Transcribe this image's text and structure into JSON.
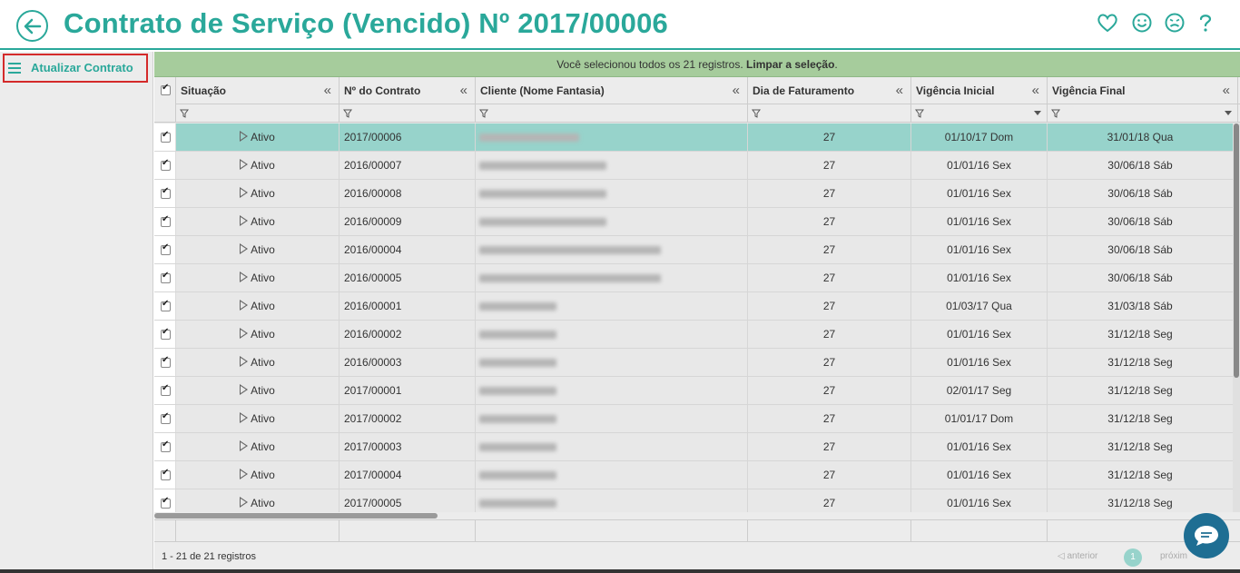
{
  "header": {
    "title": "Contrato de Serviço (Vencido) Nº 2017/00006",
    "icons": [
      "back-arrow-icon",
      "heart-icon",
      "smile-icon",
      "frown-icon",
      "question-icon"
    ]
  },
  "sidebar": {
    "items": [
      {
        "label": "Atualizar Contrato",
        "icon": "hamburger-icon"
      }
    ]
  },
  "banner": {
    "text": "Você selecionou todos os 21 registros.",
    "link": "Limpar a seleção",
    "suffix": "."
  },
  "grid": {
    "columns": [
      {
        "label": "Situação"
      },
      {
        "label": "Nº do Contrato"
      },
      {
        "label": "Cliente (Nome Fantasia)"
      },
      {
        "label": "Dia de Faturamento"
      },
      {
        "label": "Vigência Inicial"
      },
      {
        "label": "Vigência Final"
      }
    ],
    "collapse_glyph": "«",
    "rows": [
      {
        "status": "Ativo",
        "contract": "2017/00006",
        "day": "27",
        "start": "01/10/17 Dom",
        "end": "31/01/18 Qua",
        "selected": true
      },
      {
        "status": "Ativo",
        "contract": "2016/00007",
        "day": "27",
        "start": "01/01/16 Sex",
        "end": "30/06/18 Sáb"
      },
      {
        "status": "Ativo",
        "contract": "2016/00008",
        "day": "27",
        "start": "01/01/16 Sex",
        "end": "30/06/18 Sáb"
      },
      {
        "status": "Ativo",
        "contract": "2016/00009",
        "day": "27",
        "start": "01/01/16 Sex",
        "end": "30/06/18 Sáb"
      },
      {
        "status": "Ativo",
        "contract": "2016/00004",
        "day": "27",
        "start": "01/01/16 Sex",
        "end": "30/06/18 Sáb"
      },
      {
        "status": "Ativo",
        "contract": "2016/00005",
        "day": "27",
        "start": "01/01/16 Sex",
        "end": "30/06/18 Sáb"
      },
      {
        "status": "Ativo",
        "contract": "2016/00001",
        "day": "27",
        "start": "01/03/17 Qua",
        "end": "31/03/18 Sáb"
      },
      {
        "status": "Ativo",
        "contract": "2016/00002",
        "day": "27",
        "start": "01/01/16 Sex",
        "end": "31/12/18 Seg"
      },
      {
        "status": "Ativo",
        "contract": "2016/00003",
        "day": "27",
        "start": "01/01/16 Sex",
        "end": "31/12/18 Seg"
      },
      {
        "status": "Ativo",
        "contract": "2017/00001",
        "day": "27",
        "start": "02/01/17 Seg",
        "end": "31/12/18 Seg"
      },
      {
        "status": "Ativo",
        "contract": "2017/00002",
        "day": "27",
        "start": "01/01/17 Dom",
        "end": "31/12/18 Seg"
      },
      {
        "status": "Ativo",
        "contract": "2017/00003",
        "day": "27",
        "start": "01/01/16 Sex",
        "end": "31/12/18 Seg"
      },
      {
        "status": "Ativo",
        "contract": "2017/00004",
        "day": "27",
        "start": "01/01/16 Sex",
        "end": "31/12/18 Seg"
      },
      {
        "status": "Ativo",
        "contract": "2017/00005",
        "day": "27",
        "start": "01/01/16 Sex",
        "end": "31/12/18 Seg"
      }
    ]
  },
  "pager": {
    "info": "1 - 21 de 21 registros",
    "prev": "anterior",
    "page": "1",
    "next": "próxim"
  },
  "colors": {
    "accent": "#2aa89a",
    "selected_row": "#97d3cb",
    "banner": "#a6cc9c",
    "chat": "#1e6e93"
  }
}
